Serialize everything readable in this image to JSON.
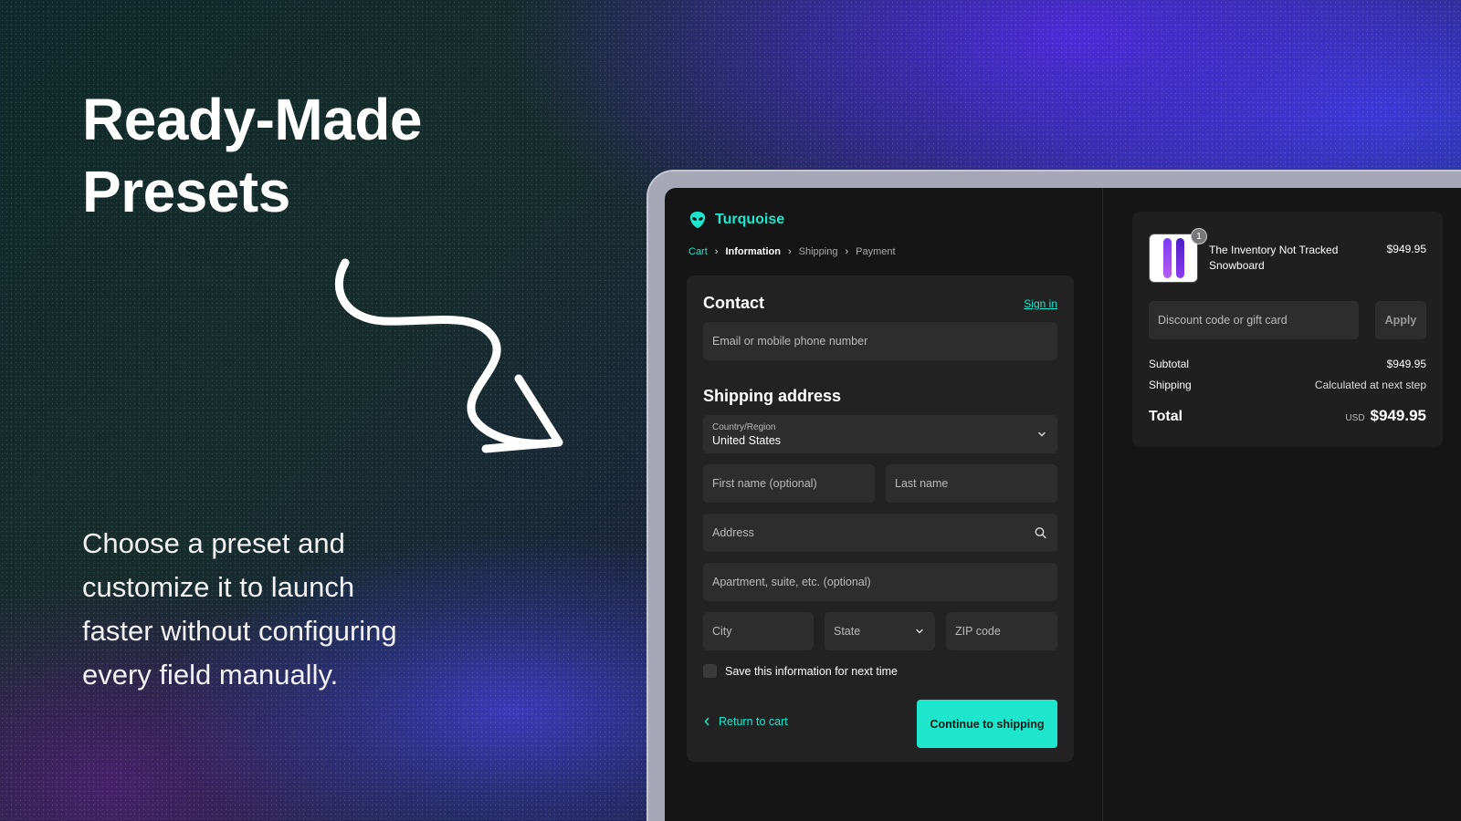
{
  "hero": {
    "title_line1": "Ready-Made",
    "title_line2": "Presets",
    "description": "Choose a preset and customize it to launch faster without configuring every field manually."
  },
  "brand": {
    "name": "Turquoise",
    "accent": "#1ee6cc"
  },
  "breadcrumbs": [
    "Cart",
    "Information",
    "Shipping",
    "Payment"
  ],
  "contact": {
    "title": "Contact",
    "sign_in": "Sign in",
    "email_placeholder": "Email or mobile phone number"
  },
  "shipping": {
    "title": "Shipping address",
    "country_label": "Country/Region",
    "country_value": "United States",
    "first_name": "First name (optional)",
    "last_name": "Last name",
    "address": "Address",
    "apartment": "Apartment, suite, etc. (optional)",
    "city": "City",
    "state": "State",
    "zip": "ZIP code",
    "save_info": "Save this information for next time",
    "return_label": "Return to cart",
    "continue_label": "Continue to shipping"
  },
  "summary": {
    "product_name": "The Inventory Not Tracked Snowboard",
    "product_price": "$949.95",
    "quantity": "1",
    "discount_placeholder": "Discount code or gift card",
    "apply_label": "Apply",
    "subtotal_label": "Subtotal",
    "subtotal_value": "$949.95",
    "shipping_label": "Shipping",
    "shipping_value": "Calculated at next step",
    "total_label": "Total",
    "currency": "USD",
    "total_value": "$949.95"
  }
}
